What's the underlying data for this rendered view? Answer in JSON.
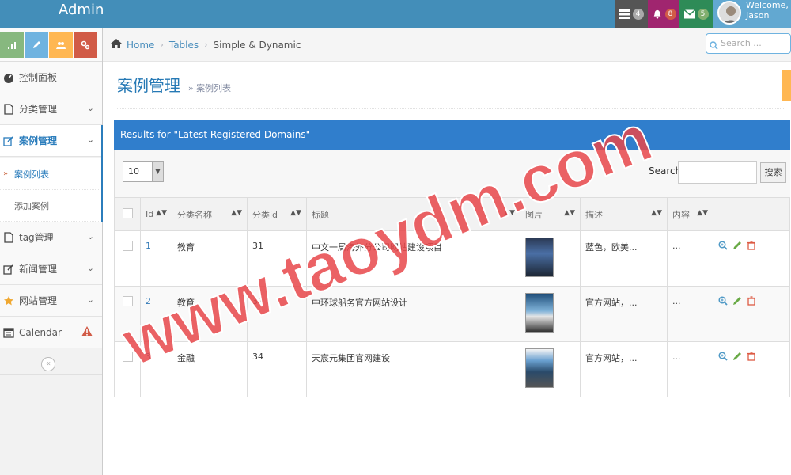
{
  "app": {
    "brand": "Admin"
  },
  "topbar": {
    "tasks_count": "4",
    "notifications_count": "8",
    "messages_count": "5",
    "welcome": "Welcome,",
    "user_name": "Jason"
  },
  "sidebar": {
    "items": [
      {
        "label": "控制面板"
      },
      {
        "label": "分类管理"
      },
      {
        "label": "案例管理"
      },
      {
        "label": "tag管理"
      },
      {
        "label": "新闻管理"
      },
      {
        "label": "网站管理"
      },
      {
        "label": "Calendar"
      }
    ],
    "subitems": [
      {
        "label": "案例列表"
      },
      {
        "label": "添加案例"
      }
    ],
    "collapse_glyph": "«"
  },
  "breadcrumb": {
    "home": "Home",
    "tables": "Tables",
    "current": "Simple & Dynamic"
  },
  "nav_search": {
    "placeholder": "Search ..."
  },
  "page_header": {
    "title": "案例管理",
    "subtitle": "案例列表"
  },
  "table_banner": "Results for \"Latest Registered Domains\"",
  "toolbar": {
    "page_length": "10",
    "search_label": "Search:",
    "search_button": "搜索"
  },
  "table": {
    "columns": [
      "Id",
      "分类名称",
      "分类id",
      "标题",
      "图片",
      "描述",
      "内容"
    ],
    "rows": [
      {
        "id": "1",
        "category": "教育",
        "category_id": "31",
        "title": "中文一局海外分公司网站建设项目",
        "desc": "蓝色，欧美...",
        "content": "..."
      },
      {
        "id": "2",
        "category": "教育",
        "category_id": "31",
        "title": "中环球船务官方网站设计",
        "desc": "官方网站，...",
        "content": "..."
      },
      {
        "id": "3",
        "category": "金融",
        "category_id": "34",
        "title": "天宸元集团官网建设",
        "desc": "官方网站，...",
        "content": "..."
      }
    ]
  },
  "colors": {
    "navbar": "#438eb9",
    "banner": "#307ecc",
    "link": "#2b7dbc",
    "watermark": "#e8474a"
  },
  "watermark": "www.taoydm.com"
}
